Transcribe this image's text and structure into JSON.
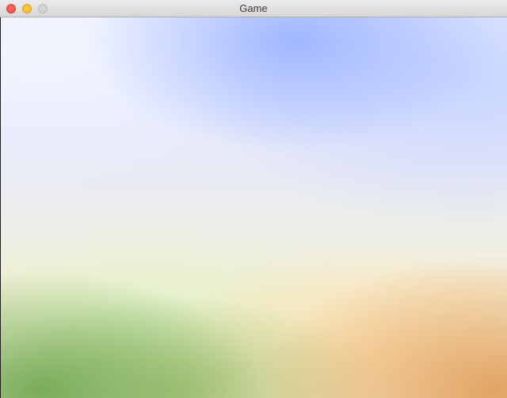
{
  "window": {
    "title": "Game"
  },
  "controls": {
    "close": "close",
    "minimize": "minimize",
    "zoom": "zoom"
  }
}
